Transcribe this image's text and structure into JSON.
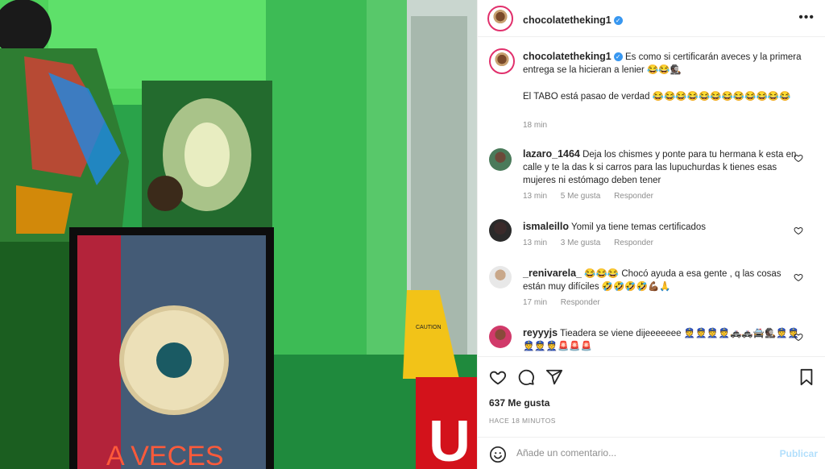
{
  "photo": {
    "frame_text": "A VECES",
    "sticker_letter": "U",
    "sign_text": "CAUTION"
  },
  "header": {
    "username": "chocolatetheking1",
    "more_icon": "more-horizontal-icon"
  },
  "caption": {
    "username": "chocolatetheking1",
    "line1": "Es como si certificarán aveces y la primera entrega se la hicieran a lenier 😂😂🕵🏿",
    "line2": "El TABO está pasao de verdad 😂😂😂😂😂😂😂😂😂😂😂😂",
    "time": "18 min"
  },
  "comments": [
    {
      "username": "lazaro_1464",
      "text": "Deja los chismes y ponte para tu hermana k esta en calle y te la das k si carros para las lupuchurdas k tienes esas mujeres ni estómago deben tener",
      "time": "13 min",
      "likes": "5 Me gusta",
      "reply": "Responder"
    },
    {
      "username": "ismaleillo",
      "text": "Yomil ya tiene temas certificados",
      "time": "13 min",
      "likes": "3 Me gusta",
      "reply": "Responder"
    },
    {
      "username": "_renivarela_",
      "text": "😂😂😂 Chocó ayuda a esa gente , q las cosas están muy difíciles 🤣🤣🤣🤣💪🏾🙏",
      "time": "17 min",
      "reply": "Responder"
    },
    {
      "username": "reyyyjs",
      "text": "Tieadera se viene dijeeeeeee 👮👮👮👮🚓🚓🚔🕵🏿👮👮👮👮👮🚨🚨🚨"
    }
  ],
  "actions": {
    "likes": "637 Me gusta",
    "time_ago": "HACE 18 MINUTOS"
  },
  "add_comment": {
    "placeholder": "Añade un comentario...",
    "post_label": "Publicar"
  },
  "colors": {
    "verified": "#3897f0",
    "post_disabled": "#b2dffc",
    "meta": "#8e8e8e"
  }
}
